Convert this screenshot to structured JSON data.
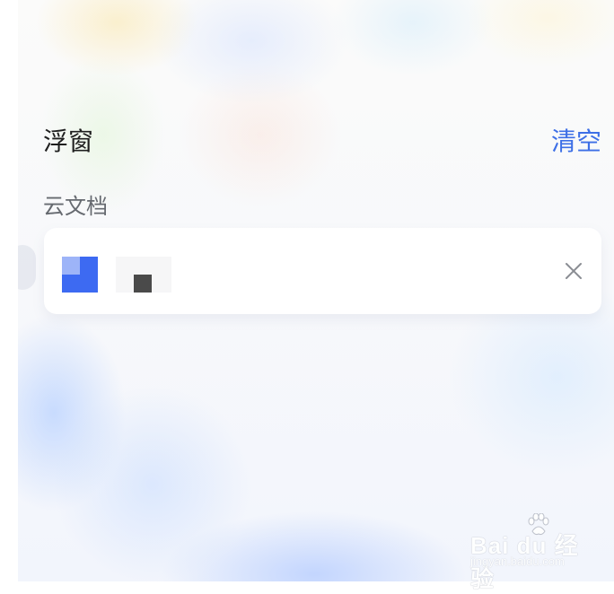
{
  "panel": {
    "title": "浮窗",
    "clear_label": "清空"
  },
  "section": {
    "label": "云文档"
  },
  "floating_item": {
    "icon": "cloud-doc-icon",
    "icon_colors": [
      "#3d6af2",
      "#9db4f8"
    ],
    "thumbnail_icon": "dark-square-thumbnail",
    "close_icon": "close-icon"
  },
  "watermark": {
    "text": "Bai du 经验",
    "url": "jingyan.baidu.com"
  },
  "colors": {
    "accent": "#3d6fe6",
    "title_text": "#1f1f1f",
    "label_text": "#666a70"
  }
}
